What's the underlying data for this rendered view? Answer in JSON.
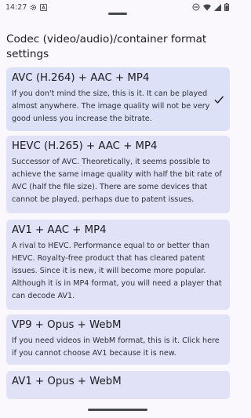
{
  "status_bar": {
    "time": "14:27",
    "left_icons": [
      "settings-gear-icon",
      "font-a-icon"
    ],
    "right_icons": [
      "dnd-icon",
      "wifi-icon",
      "cell-signal-icon",
      "battery-icon"
    ]
  },
  "sheet": {
    "title": "Codec (video/audio)/container format settings"
  },
  "options": [
    {
      "title": "AVC (H.264) + AAC + MP4",
      "description": "If you don't mind the size, this is it. It can be played almost anywhere. The image quality will not be very good unless you increase the bitrate.",
      "selected": true
    },
    {
      "title": "HEVC (H.265) + AAC + MP4",
      "description": "Successor of AVC. Theoretically, it seems possible to achieve the same image quality with half the bit rate of AVC (half the file size). There are some devices that cannot be played, perhaps due to patent issues.",
      "selected": false
    },
    {
      "title": "AV1 + AAC + MP4",
      "description": "A rival to HEVC. Performance equal to or better than HEVC. Royalty-free product that has cleared patent issues. Since it is new, it will become more popular. Although it is in MP4 format, you will need a player that can decode AV1.",
      "selected": false
    },
    {
      "title": "VP9 + Opus + WebM",
      "description": "If you need videos in WebM format, this is it. Click here if you cannot choose AV1 because it is new.",
      "selected": false
    },
    {
      "title": "AV1 + Opus + WebM",
      "description": "",
      "selected": false
    }
  ],
  "colors": {
    "accent": "#3f4ba3",
    "card": "#e1e2f7",
    "background": "#fbf8fd"
  }
}
